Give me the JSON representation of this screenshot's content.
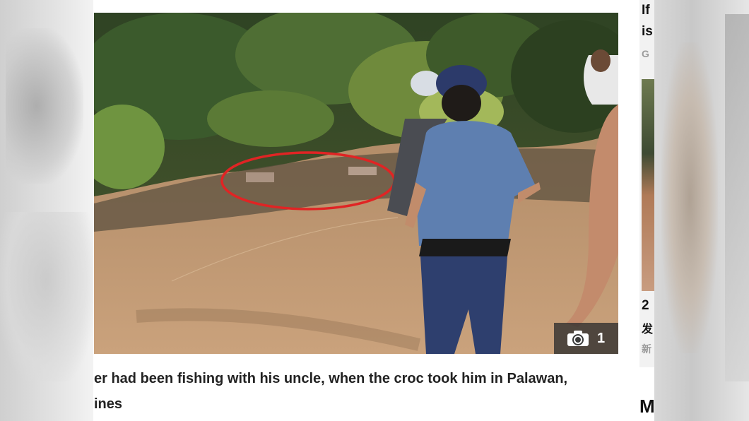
{
  "photo": {
    "gallery_count": "1",
    "camera_icon": "camera-icon",
    "circle_color": "#e02424"
  },
  "caption": {
    "line1": "er had been fishing with his uncle, when the croc took him in Palawan,",
    "line2": "ines"
  },
  "sidebar": {
    "headline_line1": "If",
    "headline_line2": "is",
    "source": "G",
    "card_title": "2",
    "card_text": "发",
    "card_meta": "新",
    "more_heading": "M"
  }
}
